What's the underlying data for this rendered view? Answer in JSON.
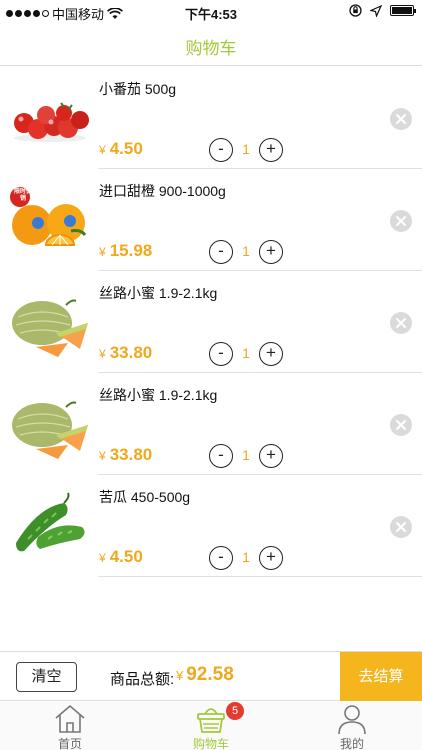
{
  "status_bar": {
    "carrier": "中国移动",
    "time": "下午4:53"
  },
  "header": {
    "title": "购物车"
  },
  "cart": {
    "currency": "¥",
    "items": [
      {
        "name": "小番茄 500g",
        "price": "4.50",
        "quantity": "1",
        "image": "cherry-tomatoes"
      },
      {
        "name": "进口甜橙 900-1000g",
        "price": "15.98",
        "quantity": "1",
        "image": "oranges",
        "promo_badge": "限时促销"
      },
      {
        "name": "丝路小蜜 1.9-2.1kg",
        "price": "33.80",
        "quantity": "1",
        "image": "melon"
      },
      {
        "name": "丝路小蜜 1.9-2.1kg",
        "price": "33.80",
        "quantity": "1",
        "image": "melon"
      },
      {
        "name": "苦瓜 450-500g",
        "price": "4.50",
        "quantity": "1",
        "image": "bitter-gourd"
      }
    ],
    "minus_label": "-",
    "plus_label": "+"
  },
  "footer": {
    "clear_label": "清空",
    "total_label": "商品总额:",
    "total_value": "92.58",
    "checkout_label": "去结算"
  },
  "tabs": [
    {
      "label": "首页",
      "icon": "home-icon"
    },
    {
      "label": "购物车",
      "icon": "basket-icon",
      "badge": "5",
      "active": true
    },
    {
      "label": "我的",
      "icon": "user-icon"
    }
  ],
  "colors": {
    "accent_green": "#a4c93a",
    "price_orange": "#f0a81c",
    "checkout_orange": "#f5b51c",
    "badge_red": "#e23b2f"
  }
}
